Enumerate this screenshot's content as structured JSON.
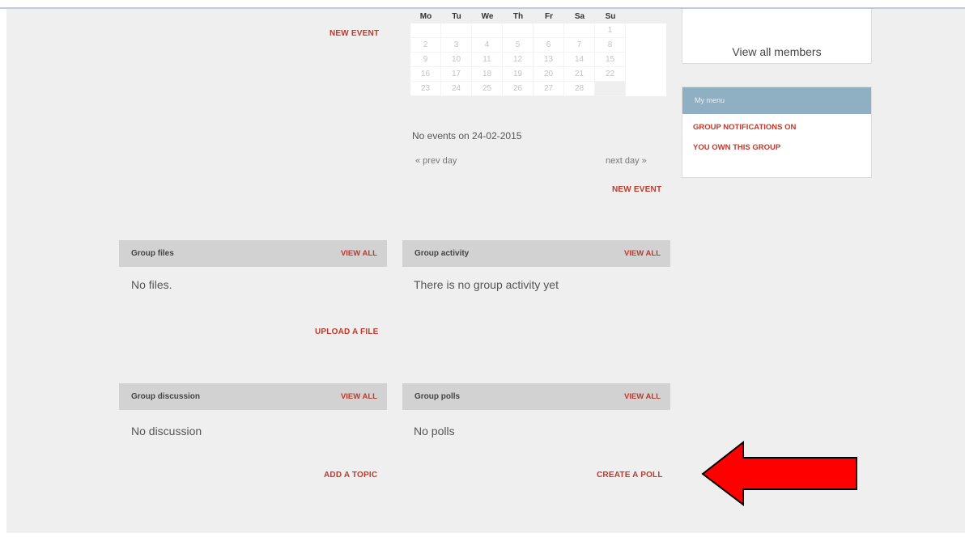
{
  "calendar": {
    "weekdays": [
      "Mo",
      "Tu",
      "We",
      "Th",
      "Fr",
      "Sa",
      "Su"
    ],
    "rows": [
      [
        "",
        "",
        "",
        "",
        "",
        "",
        "1"
      ],
      [
        "2",
        "3",
        "4",
        "5",
        "6",
        "7",
        "8"
      ],
      [
        "9",
        "10",
        "11",
        "12",
        "13",
        "14",
        "15"
      ],
      [
        "16",
        "17",
        "18",
        "19",
        "20",
        "21",
        "22"
      ],
      [
        "23",
        "24",
        "25",
        "26",
        "27",
        "28",
        ""
      ]
    ],
    "new_event_left": "NEW EVENT",
    "no_events": "No events on 24-02-2015",
    "prev_day": "« prev day",
    "next_day": "next day »",
    "new_event_right": "NEW EVENT"
  },
  "sidebar": {
    "view_all_members": "View all members",
    "menu_title": "My menu",
    "menu_items": [
      "GROUP NOTIFICATIONS ON",
      "YOU OWN THIS GROUP"
    ]
  },
  "panels": {
    "files": {
      "title": "Group files",
      "view_all": "VIEW ALL",
      "empty": "No files.",
      "action": "UPLOAD A FILE"
    },
    "activity": {
      "title": "Group activity",
      "view_all": "VIEW ALL",
      "empty": "There is no group activity yet"
    },
    "discussion": {
      "title": "Group discussion",
      "view_all": "VIEW ALL",
      "empty": "No discussion",
      "action": "ADD A TOPIC"
    },
    "polls": {
      "title": "Group polls",
      "view_all": "VIEW ALL",
      "empty": "No polls",
      "action": "CREATE A POLL"
    }
  },
  "annotation": {
    "icon": "left-arrow-icon",
    "color": "#ff0000"
  }
}
